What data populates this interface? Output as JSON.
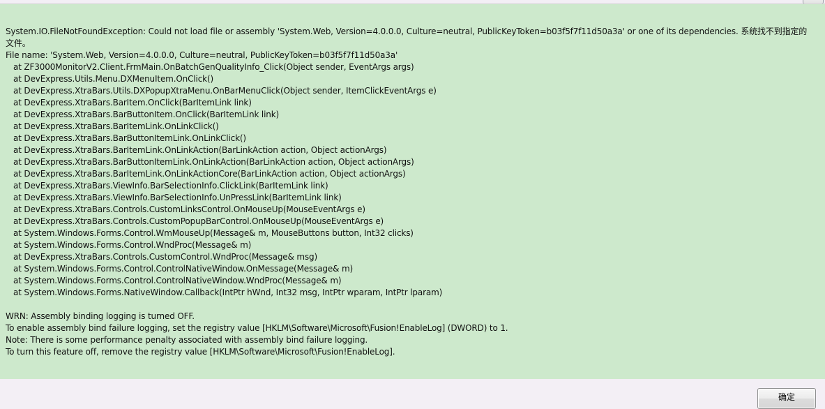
{
  "error_text": {
    "first_line": "System.IO.FileNotFoundException: Could not load file or assembly 'System.Web, Version=4.0.0.0, Culture=neutral, PublicKeyToken=b03f5f7f11d50a3a' or one of its dependencies. 系统找不到指定的文件。",
    "file_name_line": "File name: 'System.Web, Version=4.0.0.0, Culture=neutral, PublicKeyToken=b03f5f7f11d50a3a'",
    "stack_trace": [
      "   at ZF3000MonitorV2.Client.FrmMain.OnBatchGenQualityInfo_Click(Object sender, EventArgs args)",
      "   at DevExpress.Utils.Menu.DXMenuItem.OnClick()",
      "   at DevExpress.XtraBars.Utils.DXPopupXtraMenu.OnBarMenuClick(Object sender, ItemClickEventArgs e)",
      "   at DevExpress.XtraBars.BarItem.OnClick(BarItemLink link)",
      "   at DevExpress.XtraBars.BarButtonItem.OnClick(BarItemLink link)",
      "   at DevExpress.XtraBars.BarItemLink.OnLinkClick()",
      "   at DevExpress.XtraBars.BarButtonItemLink.OnLinkClick()",
      "   at DevExpress.XtraBars.BarItemLink.OnLinkAction(BarLinkAction action, Object actionArgs)",
      "   at DevExpress.XtraBars.BarButtonItemLink.OnLinkAction(BarLinkAction action, Object actionArgs)",
      "   at DevExpress.XtraBars.BarItemLink.OnLinkActionCore(BarLinkAction action, Object actionArgs)",
      "   at DevExpress.XtraBars.ViewInfo.BarSelectionInfo.ClickLink(BarItemLink link)",
      "   at DevExpress.XtraBars.ViewInfo.BarSelectionInfo.UnPressLink(BarItemLink link)",
      "   at DevExpress.XtraBars.Controls.CustomLinksControl.OnMouseUp(MouseEventArgs e)",
      "   at DevExpress.XtraBars.Controls.CustomPopupBarControl.OnMouseUp(MouseEventArgs e)",
      "   at System.Windows.Forms.Control.WmMouseUp(Message& m, MouseButtons button, Int32 clicks)",
      "   at System.Windows.Forms.Control.WndProc(Message& m)",
      "   at DevExpress.XtraBars.Controls.CustomControl.WndProc(Message& msg)",
      "   at System.Windows.Forms.Control.ControlNativeWindow.OnMessage(Message& m)",
      "   at System.Windows.Forms.Control.ControlNativeWindow.WndProc(Message& m)",
      "   at System.Windows.Forms.NativeWindow.Callback(IntPtr hWnd, Int32 msg, IntPtr wparam, IntPtr lparam)"
    ],
    "notes": [
      "WRN: Assembly binding logging is turned OFF.",
      "To enable assembly bind failure logging, set the registry value [HKLM\\Software\\Microsoft\\Fusion!EnableLog] (DWORD) to 1.",
      "Note: There is some performance penalty associated with assembly bind failure logging.",
      "To turn this feature off, remove the registry value [HKLM\\Software\\Microsoft\\Fusion!EnableLog]."
    ]
  },
  "footer": {
    "ok_label": "确定"
  },
  "colors": {
    "panel_background": "#cde9cc",
    "dialog_background": "#f3eff5"
  }
}
